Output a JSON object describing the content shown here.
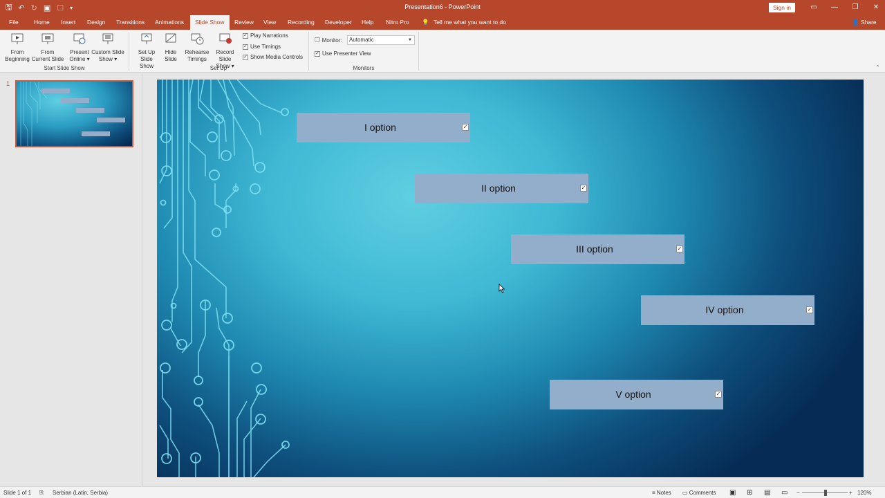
{
  "titlebar": {
    "title": "Presentation6 - PowerPoint",
    "sign_in": "Sign in",
    "qat_icons": [
      "save-icon",
      "undo-icon",
      "redo-icon",
      "start-from-beginning-icon",
      "touch-mode-icon",
      "customize-qat-icon"
    ]
  },
  "tabs": [
    "File",
    "Home",
    "Insert",
    "Design",
    "Transitions",
    "Animations",
    "Slide Show",
    "Review",
    "View",
    "Recording",
    "Developer",
    "Help",
    "Nitro Pro"
  ],
  "active_tab": "Slide Show",
  "tell_me": "Tell me what you want to do",
  "share": "Share",
  "ribbon": {
    "start_group": {
      "label": "Start Slide Show",
      "from_beginning": [
        "From",
        "Beginning"
      ],
      "from_current": [
        "From",
        "Current Slide"
      ],
      "present_online": [
        "Present",
        "Online ▾"
      ],
      "custom_show": [
        "Custom Slide",
        "Show ▾"
      ]
    },
    "setup_group": {
      "label": "Set Up",
      "setup_show": [
        "Set Up",
        "Slide Show"
      ],
      "hide_slide": [
        "Hide",
        "Slide"
      ],
      "rehearse": [
        "Rehearse",
        "Timings"
      ],
      "record": [
        "Record Slide",
        "Show ▾"
      ],
      "play_narrations": "Play Narrations",
      "use_timings": "Use Timings",
      "show_media": "Show Media Controls"
    },
    "monitors_group": {
      "label": "Monitors",
      "monitor_label": "Monitor:",
      "monitor_value": "Automatic",
      "presenter_view": "Use Presenter View"
    }
  },
  "thumbnails": [
    {
      "number": "1"
    }
  ],
  "slide": {
    "options": [
      {
        "label": "I option",
        "checked": true
      },
      {
        "label": "II option",
        "checked": true
      },
      {
        "label": "III option",
        "checked": true
      },
      {
        "label": "IV option",
        "checked": true
      },
      {
        "label": "V option",
        "checked": true
      }
    ]
  },
  "status": {
    "slide_of": "Slide 1 of 1",
    "language": "Serbian (Latin, Serbia)",
    "notes": "Notes",
    "comments": "Comments",
    "zoom": "120%"
  },
  "colors": {
    "accent": "#b7472a",
    "option_fill": "#93aecb"
  }
}
